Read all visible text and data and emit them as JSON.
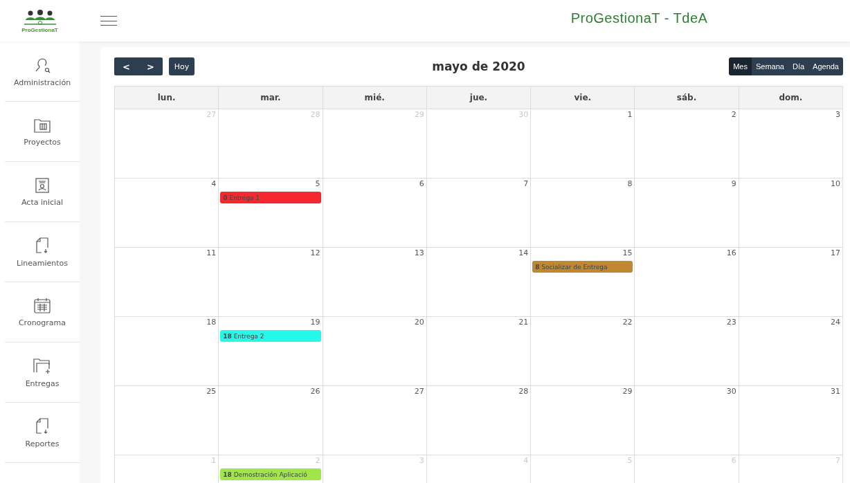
{
  "header": {
    "logo_text": "ProGestionaT",
    "title": "ProGestionaT - TdeA"
  },
  "sidebar": {
    "items": [
      {
        "label": "Administración"
      },
      {
        "label": "Proyectos"
      },
      {
        "label": "Acta inicial"
      },
      {
        "label": "Lineamientos"
      },
      {
        "label": "Cronograma"
      },
      {
        "label": "Entregas"
      },
      {
        "label": "Reportes"
      }
    ]
  },
  "calendar": {
    "nav": {
      "prev": "<",
      "next": ">",
      "today": "Hoy"
    },
    "title": "mayo de 2020",
    "views": [
      {
        "label": "Mes",
        "selected": true
      },
      {
        "label": "Semana",
        "selected": false
      },
      {
        "label": "Día",
        "selected": false
      },
      {
        "label": "Agenda",
        "selected": false
      }
    ],
    "weekdays": [
      "lun.",
      "mar.",
      "mié.",
      "jue.",
      "vie.",
      "sáb.",
      "dom."
    ],
    "weeks": [
      {
        "days": [
          {
            "day": "27",
            "other_month": true
          },
          {
            "day": "28",
            "other_month": true
          },
          {
            "day": "29",
            "other_month": true
          },
          {
            "day": "30",
            "other_month": true
          },
          {
            "day": "1",
            "other_month": false
          },
          {
            "day": "2",
            "other_month": false
          },
          {
            "day": "3",
            "other_month": false
          }
        ]
      },
      {
        "days": [
          {
            "day": "4",
            "other_month": false
          },
          {
            "day": "5",
            "other_month": false,
            "events": [
              {
                "time": "0",
                "title": "Entrega 1",
                "color": "#f5282d"
              }
            ]
          },
          {
            "day": "6",
            "other_month": false
          },
          {
            "day": "7",
            "other_month": false
          },
          {
            "day": "8",
            "other_month": false
          },
          {
            "day": "9",
            "other_month": false
          },
          {
            "day": "10",
            "other_month": false
          }
        ]
      },
      {
        "days": [
          {
            "day": "11",
            "other_month": false
          },
          {
            "day": "12",
            "other_month": false
          },
          {
            "day": "13",
            "other_month": false
          },
          {
            "day": "14",
            "other_month": false
          },
          {
            "day": "15",
            "other_month": false,
            "events": [
              {
                "time": "8",
                "title": "Socializar de Entrega",
                "color": "#c08830"
              }
            ]
          },
          {
            "day": "16",
            "other_month": false
          },
          {
            "day": "17",
            "other_month": false
          }
        ]
      },
      {
        "days": [
          {
            "day": "18",
            "other_month": false
          },
          {
            "day": "19",
            "other_month": false,
            "events": [
              {
                "time": "18",
                "title": "Entrega 2",
                "color": "#28f8e8"
              }
            ]
          },
          {
            "day": "20",
            "other_month": false
          },
          {
            "day": "21",
            "other_month": false
          },
          {
            "day": "22",
            "other_month": false
          },
          {
            "day": "23",
            "other_month": false
          },
          {
            "day": "24",
            "other_month": false
          }
        ]
      },
      {
        "days": [
          {
            "day": "25",
            "other_month": false
          },
          {
            "day": "26",
            "other_month": false
          },
          {
            "day": "27",
            "other_month": false
          },
          {
            "day": "28",
            "other_month": false
          },
          {
            "day": "29",
            "other_month": false
          },
          {
            "day": "30",
            "other_month": false
          },
          {
            "day": "31",
            "other_month": false
          }
        ]
      },
      {
        "days": [
          {
            "day": "1",
            "other_month": true
          },
          {
            "day": "2",
            "other_month": true,
            "events": [
              {
                "time": "18",
                "title": "Demostración Aplicació",
                "color": "#9ee64a"
              }
            ]
          },
          {
            "day": "3",
            "other_month": true
          },
          {
            "day": "4",
            "other_month": true
          },
          {
            "day": "5",
            "other_month": true
          },
          {
            "day": "6",
            "other_month": true
          },
          {
            "day": "7",
            "other_month": true
          }
        ]
      }
    ]
  }
}
